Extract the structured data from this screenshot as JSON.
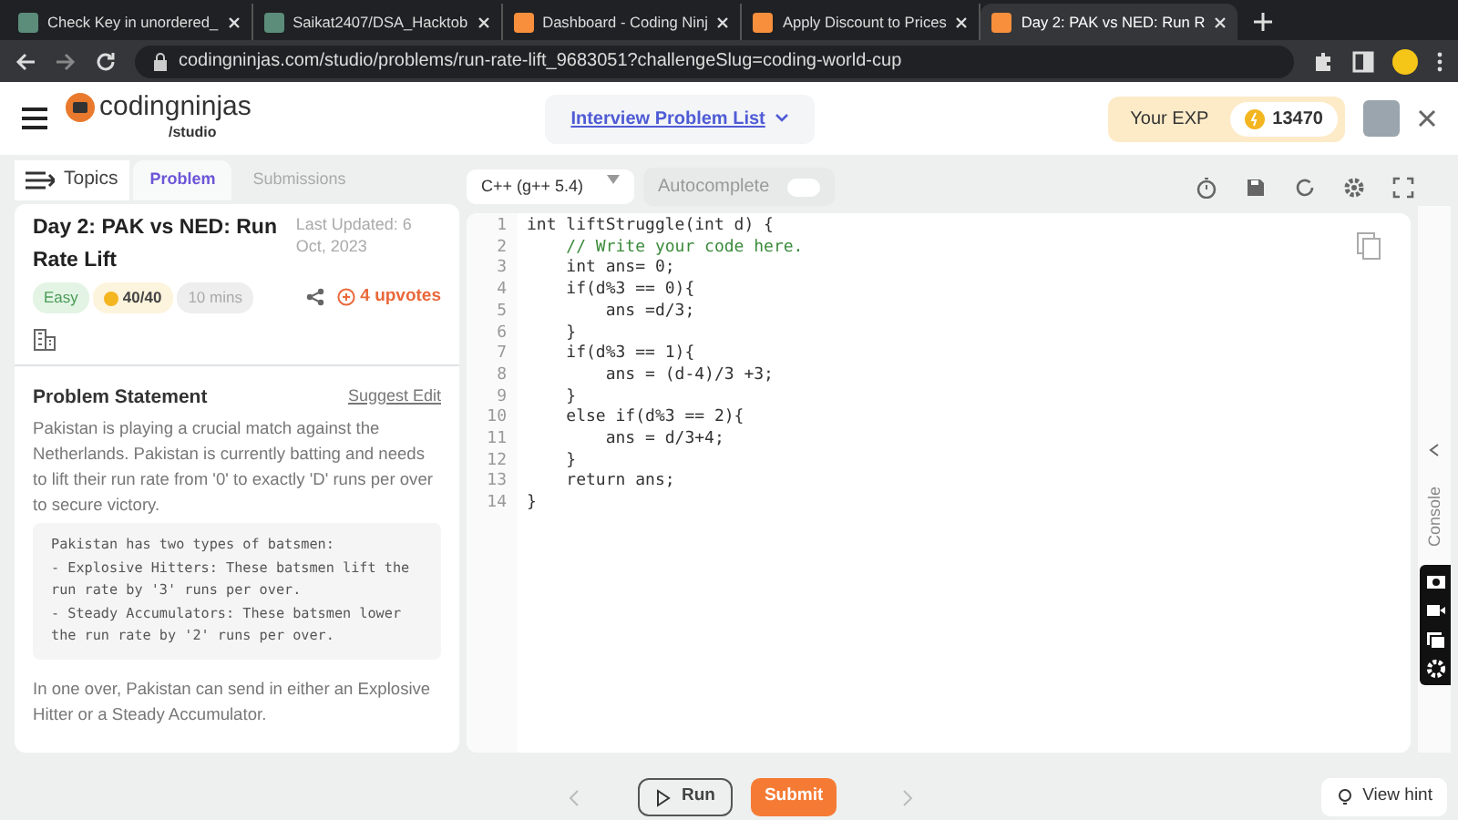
{
  "browser": {
    "tabs": [
      {
        "title": "Check Key in unordered_",
        "selected": false
      },
      {
        "title": "Saikat2407/DSA_Hacktob",
        "selected": false
      },
      {
        "title": "Dashboard - Coding Ninj",
        "selected": false
      },
      {
        "title": "Apply Discount to Prices",
        "selected": false
      },
      {
        "title": "Day 2: PAK vs NED: Run R",
        "selected": true
      }
    ],
    "url": "codingninjas.com/studio/problems/run-rate-lift_9683051?challengeSlug=coding-world-cup"
  },
  "header": {
    "logo": {
      "name": "codingninjas",
      "sub": "/studio"
    },
    "problem_list": "Interview Problem List",
    "exp_label": "Your EXP",
    "exp_value": "13470"
  },
  "left": {
    "topics": "Topics",
    "tabs": [
      {
        "label": "Problem",
        "selected": true
      },
      {
        "label": "Submissions",
        "selected": false
      }
    ],
    "title": "Day 2: PAK vs NED: Run Rate Lift",
    "updated": "Last Updated: 6 Oct, 2023",
    "badges": [
      {
        "text": "Easy",
        "kind": "difficulty"
      },
      {
        "text": "40/40",
        "kind": "score"
      },
      {
        "text": "10 mins",
        "kind": "time"
      }
    ],
    "upvotes": "4 upvotes",
    "statement_heading": "Problem Statement",
    "suggest_edit": "Suggest Edit",
    "paragraph_1": "Pakistan is playing a crucial match against the Netherlands. Pakistan is currently batting and needs to lift their run rate from '0' to exactly 'D' runs per over to secure victory.",
    "code_block": [
      "Pakistan has two types of batsmen:",
      "- Explosive Hitters: These batsmen lift the run rate by '3' runs per over.",
      "- Steady Accumulators: These batsmen lower the run rate by '2' runs per over."
    ],
    "paragraph_2": "In one over, Pakistan can send in either an Explosive Hitter or a Steady Accumulator."
  },
  "editor": {
    "language": "C++ (g++ 5.4)",
    "autocomplete": {
      "label": "Autocomplete",
      "on": false
    },
    "lines": [
      {
        "n": "1",
        "text": "int liftStruggle(int d) {",
        "kind": "code"
      },
      {
        "n": "2",
        "text": "    // Write your code here.",
        "kind": "comment"
      },
      {
        "n": "3",
        "text": "    int ans= 0;",
        "kind": "code"
      },
      {
        "n": "4",
        "text": "    if(d%3 == 0){",
        "kind": "code"
      },
      {
        "n": "5",
        "text": "        ans =d/3;",
        "kind": "code"
      },
      {
        "n": "6",
        "text": "    }",
        "kind": "code"
      },
      {
        "n": "7",
        "text": "    if(d%3 == 1){",
        "kind": "code"
      },
      {
        "n": "8",
        "text": "        ans = (d-4)/3 +3;",
        "kind": "code"
      },
      {
        "n": "9",
        "text": "    }",
        "kind": "code"
      },
      {
        "n": "10",
        "text": "    else if(d%3 == 2){",
        "kind": "code"
      },
      {
        "n": "11",
        "text": "        ans = d/3+4;",
        "kind": "code"
      },
      {
        "n": "12",
        "text": "    }",
        "kind": "code"
      },
      {
        "n": "13",
        "text": "    return ans;",
        "kind": "code"
      },
      {
        "n": "14",
        "text": "}",
        "kind": "code"
      }
    ],
    "console": "Console"
  },
  "footer": {
    "run": "Run",
    "submit": "Submit",
    "hint": "View hint"
  }
}
